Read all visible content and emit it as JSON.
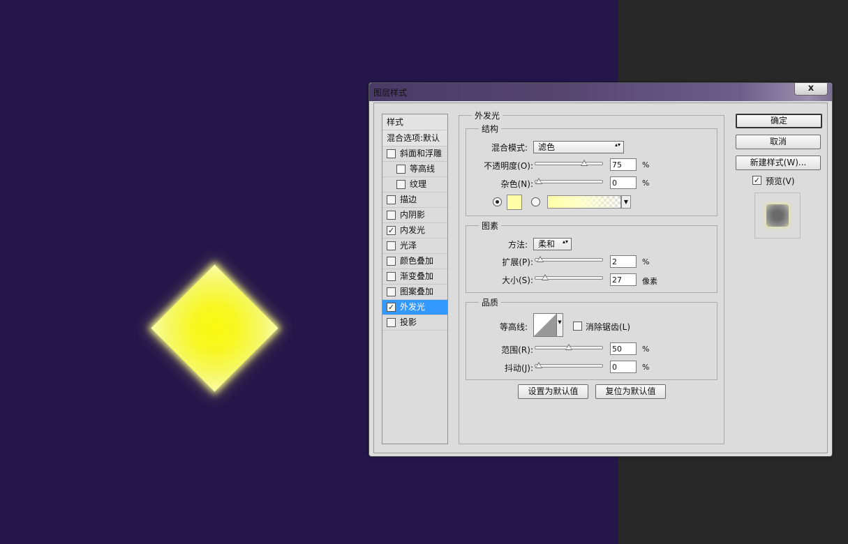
{
  "dialog": {
    "title": "图层样式",
    "close_label": "x"
  },
  "style_list": {
    "header": "样式",
    "blend_options": "混合选项:默认",
    "items": [
      {
        "label": "斜面和浮雕",
        "checked": false,
        "indent": false
      },
      {
        "label": "等高线",
        "checked": false,
        "indent": true
      },
      {
        "label": "纹理",
        "checked": false,
        "indent": true
      },
      {
        "label": "描边",
        "checked": false,
        "indent": false
      },
      {
        "label": "内阴影",
        "checked": false,
        "indent": false
      },
      {
        "label": "内发光",
        "checked": true,
        "indent": false
      },
      {
        "label": "光泽",
        "checked": false,
        "indent": false
      },
      {
        "label": "颜色叠加",
        "checked": false,
        "indent": false
      },
      {
        "label": "渐变叠加",
        "checked": false,
        "indent": false
      },
      {
        "label": "图案叠加",
        "checked": false,
        "indent": false
      },
      {
        "label": "外发光",
        "checked": true,
        "indent": false,
        "selected": true
      },
      {
        "label": "投影",
        "checked": false,
        "indent": false
      }
    ],
    "check_mark": "✓"
  },
  "panel": {
    "title": "外发光",
    "structure": {
      "title": "结构",
      "blend_mode_label": "混合模式:",
      "blend_mode_value": "滤色",
      "opacity_label": "不透明度(O):",
      "opacity_value": "75",
      "opacity_unit": "%",
      "opacity_fraction": 0.75,
      "noise_label": "杂色(N):",
      "noise_value": "0",
      "noise_unit": "%",
      "noise_fraction": 0.0,
      "glow_color": "#ffffa8"
    },
    "elements": {
      "title": "图素",
      "technique_label": "方法:",
      "technique_value": "柔和",
      "spread_label": "扩展(P):",
      "spread_value": "2",
      "spread_unit": "%",
      "spread_fraction": 0.02,
      "size_label": "大小(S):",
      "size_value": "27",
      "size_unit": "像素",
      "size_fraction": 0.11
    },
    "quality": {
      "title": "品质",
      "contour_label": "等高线:",
      "antialias_label": "消除锯齿(L)",
      "range_label": "范围(R):",
      "range_value": "50",
      "range_unit": "%",
      "range_fraction": 0.5,
      "jitter_label": "抖动(J):",
      "jitter_value": "0",
      "jitter_unit": "%",
      "jitter_fraction": 0.0
    },
    "make_default_label": "设置为默认值",
    "reset_default_label": "复位为默认值"
  },
  "actions": {
    "ok_label": "确定",
    "cancel_label": "取消",
    "new_style_label": "新建样式(W)...",
    "preview_label": "预览(V)",
    "preview_checked": true
  },
  "colors": {
    "canvas": "#24164b",
    "selection": "#3399ff",
    "shape_fill": "#f7f722"
  }
}
